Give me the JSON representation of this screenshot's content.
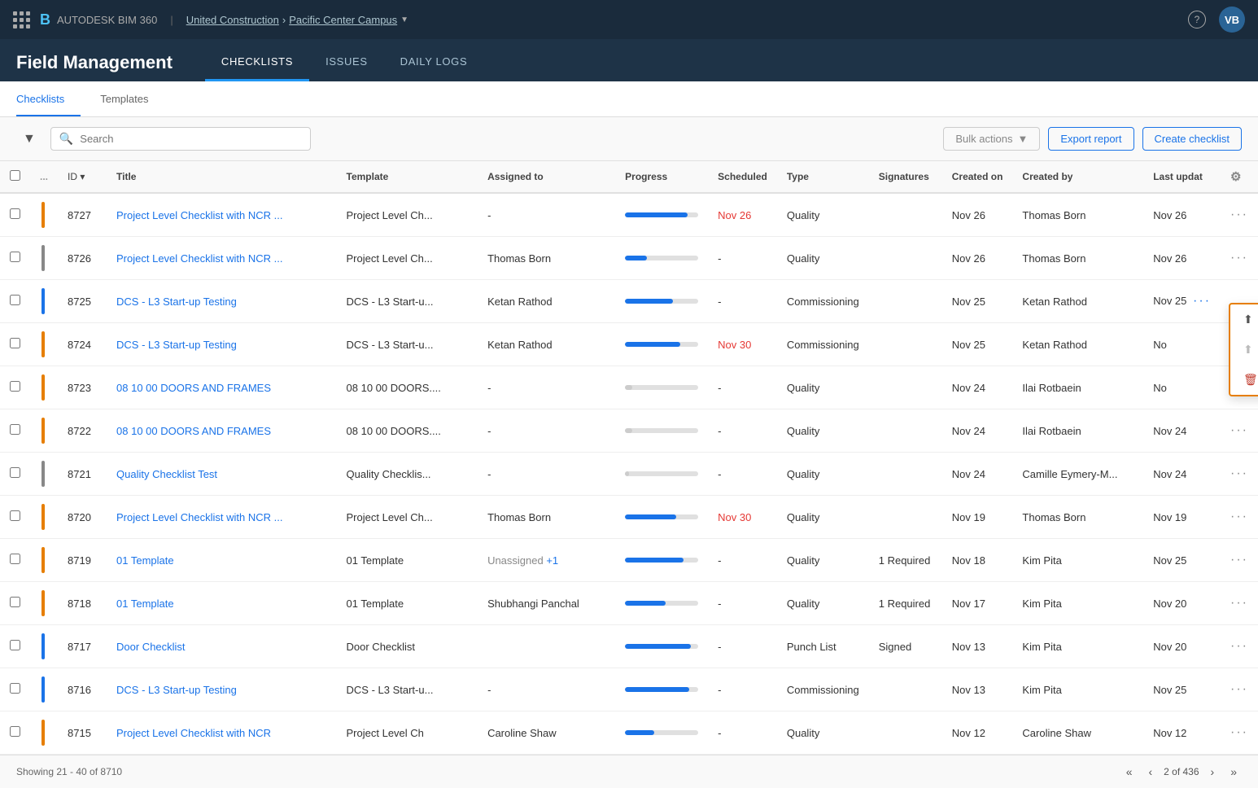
{
  "app": {
    "logo": "B",
    "company": "AUTODESK BIM 360",
    "org": "United Construction",
    "project": "Pacific Center Campus",
    "user_initials": "VB"
  },
  "nav": {
    "title": "Field Management",
    "tabs": [
      {
        "id": "checklists",
        "label": "CHECKLISTS",
        "active": true
      },
      {
        "id": "issues",
        "label": "ISSUES",
        "active": false
      },
      {
        "id": "daily-logs",
        "label": "DAILY LOGS",
        "active": false
      }
    ]
  },
  "sub_tabs": [
    {
      "id": "checklists",
      "label": "Checklists",
      "active": true
    },
    {
      "id": "templates",
      "label": "Templates",
      "active": false
    }
  ],
  "toolbar": {
    "search_placeholder": "Search",
    "bulk_actions": "Bulk actions",
    "export_report": "Export report",
    "create_checklist": "Create checklist"
  },
  "table": {
    "columns": [
      "",
      "...",
      "ID",
      "Title",
      "Template",
      "Assigned to",
      "Progress",
      "Scheduled",
      "Type",
      "Signatures",
      "Created on",
      "Created by",
      "Last updat"
    ],
    "rows": [
      {
        "id": "8727",
        "color": "#e67e00",
        "title": "Project Level Checklist with NCR ...",
        "template": "Project Level Ch...",
        "assigned_to": "-",
        "progress": 85,
        "progress_color": "#1a73e8",
        "scheduled": "Nov 26",
        "scheduled_overdue": true,
        "type": "Quality",
        "signatures": "",
        "created_on": "Nov 26",
        "created_by": "Thomas Born",
        "last_updated": "Nov 26",
        "show_menu": false
      },
      {
        "id": "8726",
        "color": "#888",
        "title": "Project Level Checklist with NCR ...",
        "template": "Project Level Ch...",
        "assigned_to": "Thomas Born",
        "progress": 30,
        "progress_color": "#1a73e8",
        "scheduled": "-",
        "scheduled_overdue": false,
        "type": "Quality",
        "signatures": "",
        "created_on": "Nov 26",
        "created_by": "Thomas Born",
        "last_updated": "Nov 26",
        "show_menu": false
      },
      {
        "id": "8725",
        "color": "#1a73e8",
        "title": "DCS - L3 Start-up Testing",
        "template": "DCS - L3 Start-u...",
        "assigned_to": "Ketan Rathod",
        "progress": 65,
        "progress_color": "#1a73e8",
        "scheduled": "-",
        "scheduled_overdue": false,
        "type": "Commissioning",
        "signatures": "",
        "created_on": "Nov 25",
        "created_by": "Ketan Rathod",
        "last_updated": "Nov 25",
        "show_menu": true
      },
      {
        "id": "8724",
        "color": "#e67e00",
        "title": "DCS - L3 Start-up Testing",
        "template": "DCS - L3 Start-u...",
        "assigned_to": "Ketan Rathod",
        "progress": 75,
        "progress_color": "#1a73e8",
        "scheduled": "Nov 30",
        "scheduled_overdue": true,
        "type": "Commissioning",
        "signatures": "",
        "created_on": "Nov 25",
        "created_by": "Ketan Rathod",
        "last_updated": "No",
        "show_menu": false
      },
      {
        "id": "8723",
        "color": "#e67e00",
        "title": "08 10 00 DOORS AND FRAMES",
        "template": "08 10 00 DOORS....",
        "assigned_to": "-",
        "progress": 10,
        "progress_color": "#e0e0e0",
        "scheduled": "-",
        "scheduled_overdue": false,
        "type": "Quality",
        "signatures": "",
        "created_on": "Nov 24",
        "created_by": "Ilai Rotbaein",
        "last_updated": "No",
        "show_menu": false
      },
      {
        "id": "8722",
        "color": "#e67e00",
        "title": "08 10 00 DOORS AND FRAMES",
        "template": "08 10 00 DOORS....",
        "assigned_to": "-",
        "progress": 10,
        "progress_color": "#e0e0e0",
        "scheduled": "-",
        "scheduled_overdue": false,
        "type": "Quality",
        "signatures": "",
        "created_on": "Nov 24",
        "created_by": "Ilai Rotbaein",
        "last_updated": "Nov 24",
        "show_menu": false
      },
      {
        "id": "8721",
        "color": "#888",
        "title": "Quality Checklist Test",
        "template": "Quality Checklis...",
        "assigned_to": "-",
        "progress": 5,
        "progress_color": "#e0e0e0",
        "scheduled": "-",
        "scheduled_overdue": false,
        "type": "Quality",
        "signatures": "",
        "created_on": "Nov 24",
        "created_by": "Camille Eymery-M...",
        "last_updated": "Nov 24",
        "show_menu": false
      },
      {
        "id": "8720",
        "color": "#e67e00",
        "title": "Project Level Checklist with NCR ...",
        "template": "Project Level Ch...",
        "assigned_to": "Thomas Born",
        "progress": 70,
        "progress_color": "#1a73e8",
        "scheduled": "Nov 30",
        "scheduled_overdue": true,
        "type": "Quality",
        "signatures": "",
        "created_on": "Nov 19",
        "created_by": "Thomas Born",
        "last_updated": "Nov 19",
        "show_menu": false
      },
      {
        "id": "8719",
        "color": "#e67e00",
        "title": "01 Template",
        "template": "01 Template",
        "assigned_to": "Unassigned +1",
        "assigned_link": true,
        "progress": 80,
        "progress_color": "#1a73e8",
        "scheduled": "-",
        "scheduled_overdue": false,
        "type": "Quality",
        "signatures": "1 Required",
        "created_on": "Nov 18",
        "created_by": "Kim Pita",
        "last_updated": "Nov 25",
        "show_menu": false
      },
      {
        "id": "8718",
        "color": "#e67e00",
        "title": "01 Template",
        "template": "01 Template",
        "assigned_to": "Shubhangi Panchal",
        "progress": 55,
        "progress_color": "#1a73e8",
        "scheduled": "-",
        "scheduled_overdue": false,
        "type": "Quality",
        "signatures": "1 Required",
        "created_on": "Nov 17",
        "created_by": "Kim Pita",
        "last_updated": "Nov 20",
        "show_menu": false
      },
      {
        "id": "8717",
        "color": "#1a73e8",
        "title": "Door Checklist",
        "template": "Door Checklist",
        "assigned_to": "",
        "progress": 90,
        "progress_color": "#1a73e8",
        "scheduled": "-",
        "scheduled_overdue": false,
        "type": "Punch List",
        "signatures": "Signed",
        "created_on": "Nov 13",
        "created_by": "Kim Pita",
        "last_updated": "Nov 20",
        "show_menu": false
      },
      {
        "id": "8716",
        "color": "#1a73e8",
        "title": "DCS - L3 Start-up Testing",
        "template": "DCS - L3 Start-u...",
        "assigned_to": "-",
        "progress": 88,
        "progress_color": "#1a73e8",
        "scheduled": "-",
        "scheduled_overdue": false,
        "type": "Commissioning",
        "signatures": "",
        "created_on": "Nov 13",
        "created_by": "Kim Pita",
        "last_updated": "Nov 25",
        "show_menu": false
      },
      {
        "id": "8715",
        "color": "#e67e00",
        "title": "Project Level Checklist with NCR",
        "template": "Project Level Ch",
        "assigned_to": "Caroline Shaw",
        "progress": 40,
        "progress_color": "#1a73e8",
        "scheduled": "-",
        "scheduled_overdue": false,
        "type": "Quality",
        "signatures": "",
        "created_on": "Nov 12",
        "created_by": "Caroline Shaw",
        "last_updated": "Nov 12",
        "show_menu": false
      }
    ],
    "context_menu": {
      "items": [
        {
          "id": "archive",
          "label": "Archive",
          "icon": "⬆",
          "disabled": false
        },
        {
          "id": "restore",
          "label": "Restore",
          "icon": "⬆",
          "disabled": true
        },
        {
          "id": "delete",
          "label": "Delete",
          "icon": "🗑",
          "disabled": false,
          "danger": true
        }
      ]
    }
  },
  "footer": {
    "showing": "Showing 21 - 40 of 8710",
    "page_info": "2 of 436"
  }
}
